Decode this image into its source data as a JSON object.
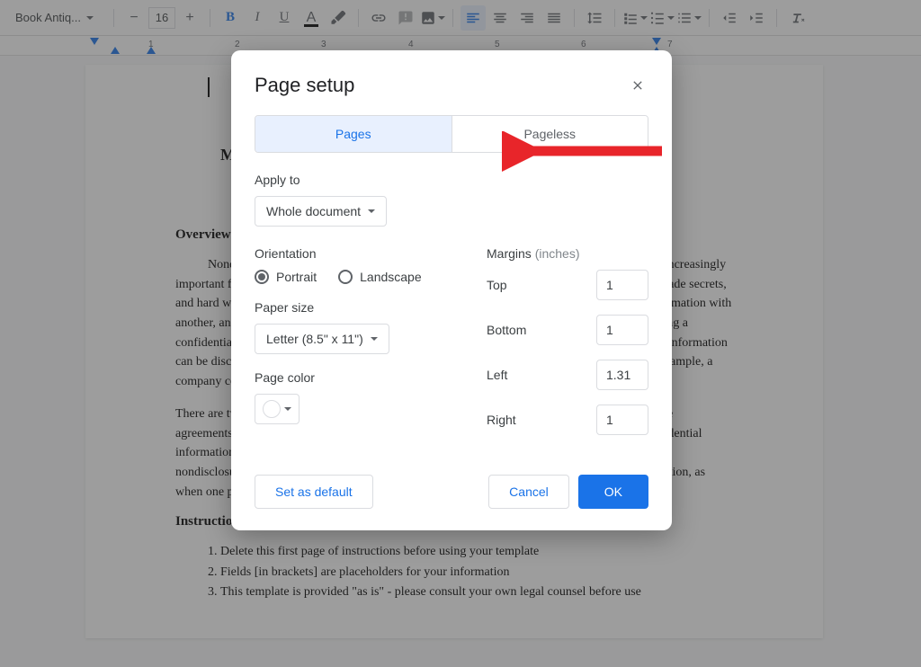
{
  "toolbar": {
    "font_name": "Book Antiq...",
    "font_size": "16"
  },
  "ruler": {
    "ticks": [
      "1",
      "2",
      "3",
      "4",
      "5",
      "6",
      "7"
    ]
  },
  "document": {
    "title": "MUT",
    "h_overview": "Overview",
    "p1": "Nondisclosure agreements (also called NDAs or confidentiality agreements) have become increasingly important for businesses of all sizes, serving as the first line of defense in protecting inventions, trade secrets, and hard work. These agreements are critical when at least one person is sharing confidential information with another, and it's crucial the immediate and future privacy of said information be maintained. Having a confidentiality agreement allows for open dialog between parties, creating an environment where information can be discussed freely and the true purpose of the meeting or relationship can be achieved (for example, a company could be acquired or a strategic partnership could be created).",
    "p2": "There are two key types of nondisclosure agreements: unilateral and mutual. Mutual nondisclosure agreements (like the one in this document) should be used when both parties will be sharing confidential information, as when the parties are considering a partnership, joint venture, or merger. Unilateral nondisclosure agreements should be used when only one side will be sharing confidential information, as when one party is seeking funding for or investment in a company.",
    "h_instructions": "Instructions",
    "li1": "Delete this first page of instructions before using your template",
    "li2": "Fields [in brackets] are placeholders for your information",
    "li3": "This template is provided \"as is\" - please consult your own legal counsel before use"
  },
  "dialog": {
    "title": "Page setup",
    "tab_pages": "Pages",
    "tab_pageless": "Pageless",
    "apply_to_label": "Apply to",
    "apply_to_value": "Whole document",
    "orientation_label": "Orientation",
    "orientation_portrait": "Portrait",
    "orientation_landscape": "Landscape",
    "paper_size_label": "Paper size",
    "paper_size_value": "Letter (8.5\" x 11\")",
    "page_color_label": "Page color",
    "margins_label": "Margins",
    "margins_unit": "(inches)",
    "margin_top_label": "Top",
    "margin_top_value": "1",
    "margin_bottom_label": "Bottom",
    "margin_bottom_value": "1",
    "margin_left_label": "Left",
    "margin_left_value": "1.31",
    "margin_right_label": "Right",
    "margin_right_value": "1",
    "set_default": "Set as default",
    "cancel": "Cancel",
    "ok": "OK"
  }
}
